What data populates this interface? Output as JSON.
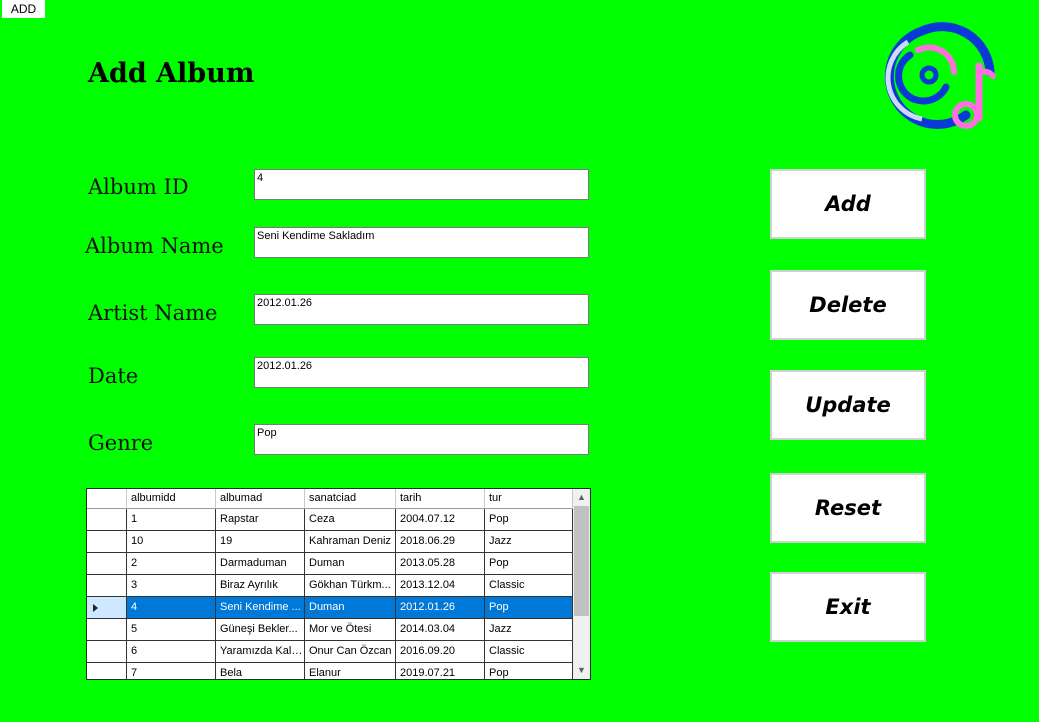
{
  "window": {
    "title": "ADD"
  },
  "page": {
    "heading": "Add Album"
  },
  "colors": {
    "background": "#00ff00",
    "selection": "#0078d7"
  },
  "logo": {
    "icon": "music-disc-logo-icon"
  },
  "form": {
    "album_id": {
      "label": "Album ID",
      "value": "4"
    },
    "album_name": {
      "label": "Album Name",
      "value": "Seni Kendime Sakladım"
    },
    "artist_name": {
      "label": "Artist Name",
      "value": "2012.01.26"
    },
    "date": {
      "label": "Date",
      "value": "2012.01.26"
    },
    "genre": {
      "label": "Genre",
      "value": "Pop"
    }
  },
  "buttons": {
    "add": "Add",
    "delete": "Delete",
    "update": "Update",
    "reset": "Reset",
    "exit": "Exit"
  },
  "grid": {
    "columns": [
      "albumidd",
      "albumad",
      "sanatciad",
      "tarih",
      "tur"
    ],
    "rows": [
      [
        "1",
        "Rapstar",
        "Ceza",
        "2004.07.12",
        "Pop"
      ],
      [
        "10",
        "19",
        "Kahraman Deniz",
        "2018.06.29",
        "Jazz"
      ],
      [
        "2",
        "Darmaduman",
        "Duman",
        "2013.05.28",
        "Pop"
      ],
      [
        "3",
        "Biraz Ayrılık",
        "Gökhan Türkm...",
        "2013.12.04",
        "Classic"
      ],
      [
        "4",
        "Seni Kendime ...",
        "Duman",
        "2012.01.26",
        "Pop"
      ],
      [
        "5",
        "Güneşi Bekler...",
        "Mor ve Ötesi",
        "2014.03.04",
        "Jazz"
      ],
      [
        "6",
        "Yaramızda Kalsın",
        "Onur Can Özcan",
        "2016.09.20",
        "Classic"
      ],
      [
        "7",
        "Bela",
        "Elanur",
        "2019.07.21",
        "Pop"
      ]
    ],
    "selected_row": 4
  }
}
